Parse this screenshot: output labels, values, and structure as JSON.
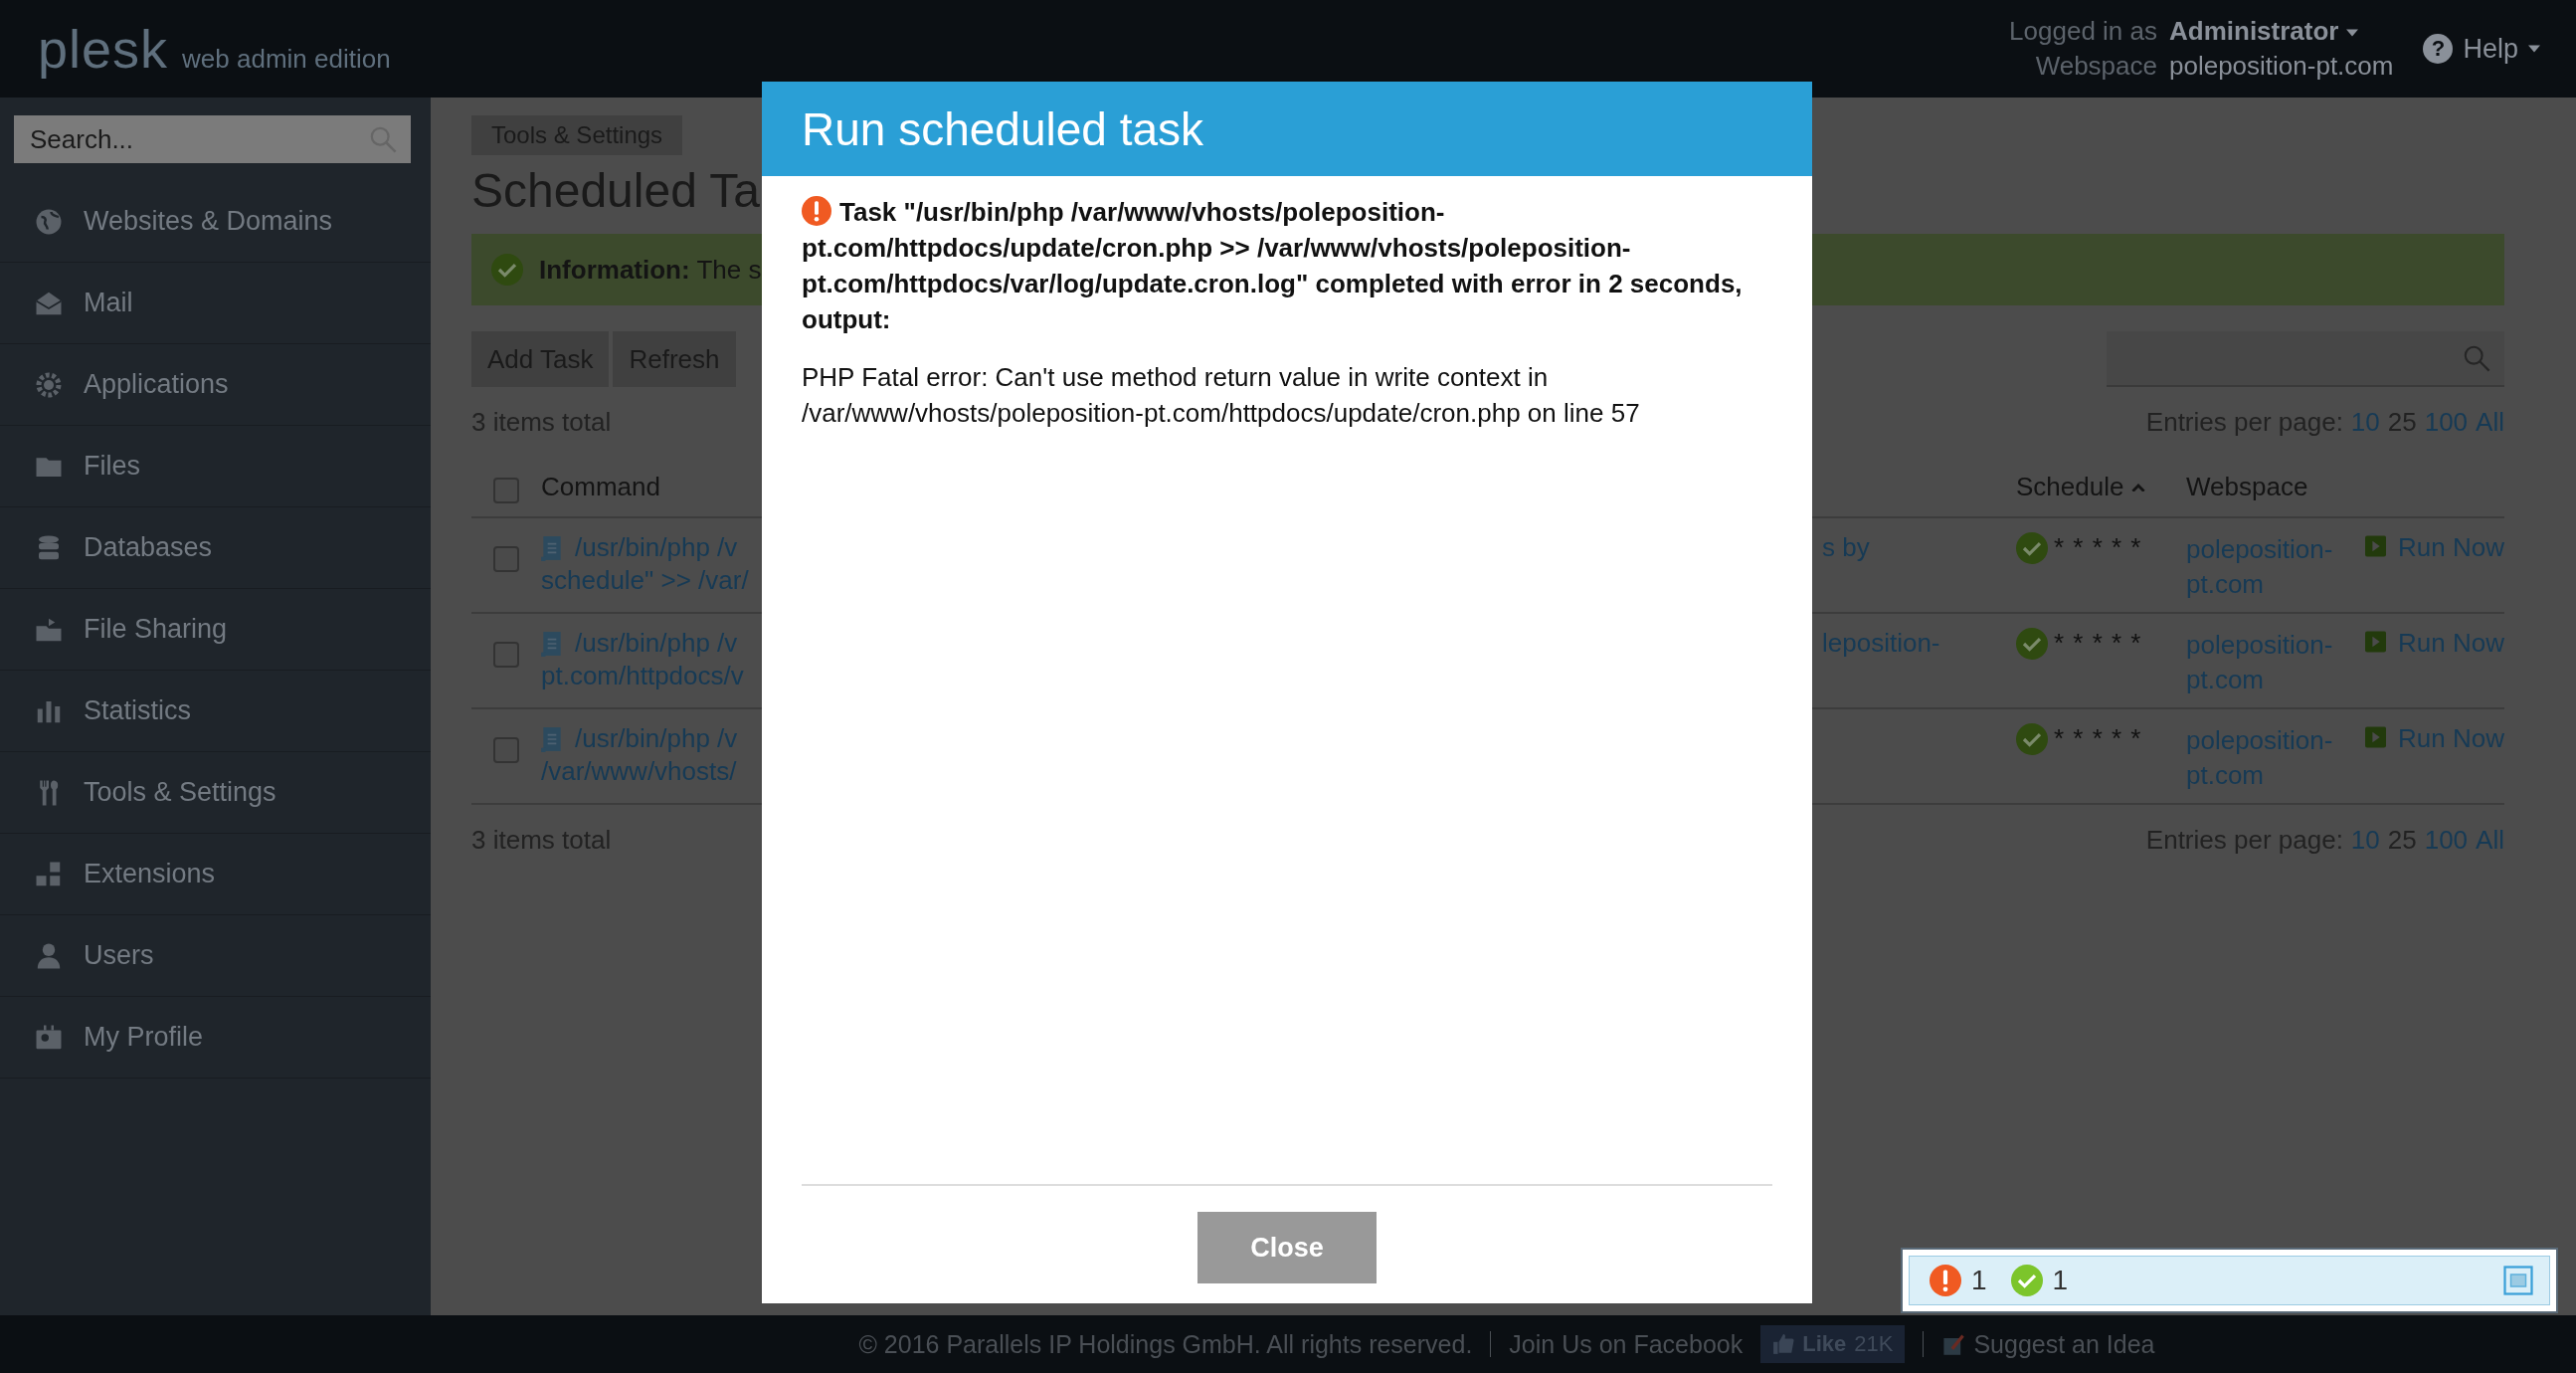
{
  "header": {
    "logo": "plesk",
    "edition": "web admin edition",
    "logged_in_label": "Logged in as",
    "user": "Administrator",
    "webspace_label": "Webspace",
    "webspace": "poleposition-pt.com",
    "help_icon": "?",
    "help": "Help"
  },
  "sidebar": {
    "search_placeholder": "Search...",
    "items": [
      {
        "label": "Websites & Domains"
      },
      {
        "label": "Mail"
      },
      {
        "label": "Applications"
      },
      {
        "label": "Files"
      },
      {
        "label": "Databases"
      },
      {
        "label": "File Sharing"
      },
      {
        "label": "Statistics"
      },
      {
        "label": "Tools & Settings"
      },
      {
        "label": "Extensions"
      },
      {
        "label": "Users"
      },
      {
        "label": "My Profile"
      }
    ]
  },
  "breadcrumb": "Tools & Settings",
  "title": "Scheduled Ta",
  "info": {
    "label": "Information:",
    "text": "The s"
  },
  "toolbar": {
    "buttons": [
      "Add Task",
      "Refresh"
    ]
  },
  "list_top": {
    "total": "3 items total",
    "entries_label": "Entries per page:",
    "page_sizes": [
      {
        "label": "10",
        "selected": false
      },
      {
        "label": "25",
        "selected": true
      },
      {
        "label": "100",
        "selected": false
      },
      {
        "label": "All",
        "selected": false
      }
    ]
  },
  "table": {
    "select_all_checked": false,
    "columns": [
      "Command",
      "Schedule",
      "Webspace"
    ],
    "rows": [
      {
        "checked": false,
        "command_line1": "/usr/bin/php /v",
        "command_line2": "schedule\" >> /var/",
        "command_right": "s by",
        "active": true,
        "schedule": "* * * * *",
        "webspace": "poleposition-pt.com",
        "action": "Run Now"
      },
      {
        "checked": false,
        "command_line1": "/usr/bin/php /v",
        "command_line2": "pt.com/httpdocs/v",
        "command_right": "leposition-",
        "active": true,
        "schedule": "* * * * *",
        "webspace": "poleposition-pt.com",
        "action": "Run Now"
      },
      {
        "checked": false,
        "command_line1": "/usr/bin/php /v",
        "command_line2": "/var/www/vhosts/",
        "active": true,
        "schedule": "* * * * *",
        "webspace": "poleposition-pt.com",
        "action": "Run Now"
      }
    ]
  },
  "list_bottom": {
    "total": "3 items total",
    "entries_label": "Entries per page:",
    "page_sizes": [
      {
        "label": "10",
        "selected": false
      },
      {
        "label": "25",
        "selected": true
      },
      {
        "label": "100",
        "selected": false
      },
      {
        "label": "All",
        "selected": false
      }
    ]
  },
  "modal": {
    "title": "Run scheduled task",
    "message": "Task \"/usr/bin/php /var/www/vhosts/poleposition-pt.com/httpdocs/update/cron.php >> /var/www/vhosts/poleposition-pt.com/httpdocs/var/log/update.cron.log\" completed with error in 2 seconds, output:",
    "output": "PHP Fatal error: Can't use method return value in write context in /var/www/vhosts/poleposition-pt.com/httpdocs/update/cron.php on line 57",
    "button": "Close"
  },
  "notifications": {
    "errors": "1",
    "successes": "1"
  },
  "footer": {
    "copyright": "© 2016 Parallels IP Holdings GmbH. All rights reserved.",
    "facebook": "Join Us on Facebook",
    "like": "Like",
    "like_count": "21K",
    "suggest": "Suggest an Idea"
  }
}
